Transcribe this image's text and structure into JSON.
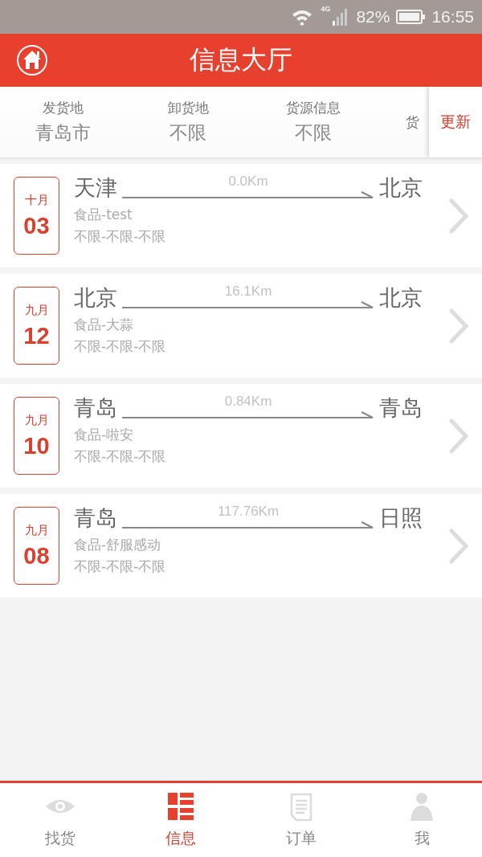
{
  "status_bar": {
    "network": "4G",
    "battery": "82%",
    "time": "16:55"
  },
  "header": {
    "title": "信息大厅"
  },
  "filters": [
    {
      "label": "发货地",
      "value": "青岛市"
    },
    {
      "label": "卸货地",
      "value": "不限"
    },
    {
      "label": "货源信息",
      "value": "不限"
    },
    {
      "label": "货"
    }
  ],
  "refresh_button": "更新",
  "listings": [
    {
      "month": "十月",
      "day": "03",
      "origin": "天津",
      "distance": "0.0Km",
      "destination": "北京",
      "cargo": "食品-test",
      "specs": "不限-不限-不限"
    },
    {
      "month": "九月",
      "day": "12",
      "origin": "北京",
      "distance": "16.1Km",
      "destination": "北京",
      "cargo": "食品-大蒜",
      "specs": "不限-不限-不限"
    },
    {
      "month": "九月",
      "day": "10",
      "origin": "青岛",
      "distance": "0.84Km",
      "destination": "青岛",
      "cargo": "食品-啦安",
      "specs": "不限-不限-不限"
    },
    {
      "month": "九月",
      "day": "08",
      "origin": "青岛",
      "distance": "117.76Km",
      "destination": "日照",
      "cargo": "食品-舒服感动",
      "specs": "不限-不限-不限"
    }
  ],
  "tabs": [
    {
      "label": "找货",
      "kind": "eye",
      "selected": false
    },
    {
      "label": "信息",
      "kind": "list",
      "selected": true
    },
    {
      "label": "订单",
      "kind": "notepad",
      "selected": false
    },
    {
      "label": "我",
      "kind": "person",
      "selected": false
    }
  ]
}
